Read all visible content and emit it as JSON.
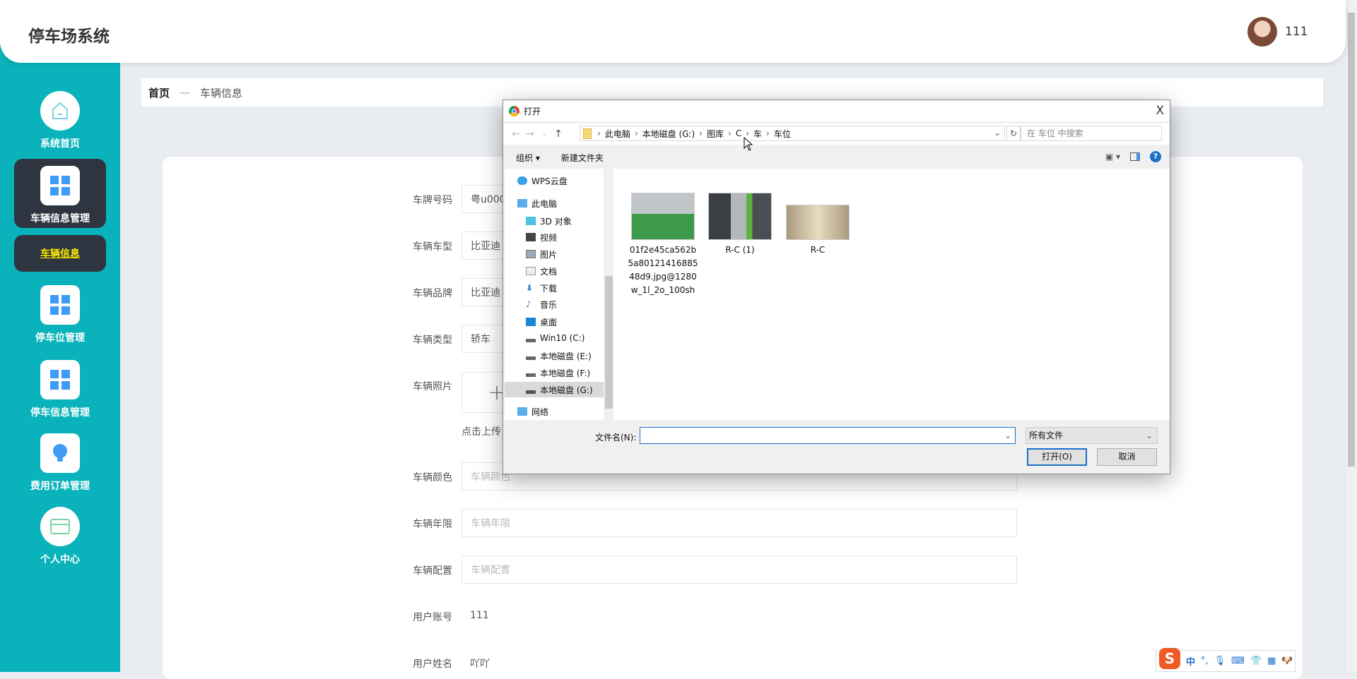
{
  "header": {
    "title": "停车场系统",
    "user": "111"
  },
  "sidebar": {
    "items": [
      {
        "label": "系统首页",
        "icon": "home-icon"
      },
      {
        "label": "车辆信息管理",
        "icon": "grid-icon",
        "active": true
      },
      {
        "label": "停车位管理",
        "icon": "grid-icon"
      },
      {
        "label": "停车信息管理",
        "icon": "grid-icon"
      },
      {
        "label": "费用订单管理",
        "icon": "lightbulb-icon"
      },
      {
        "label": "个人中心",
        "icon": "card-icon"
      }
    ],
    "sub_item": "车辆信息",
    "accent": "#0ab3bb"
  },
  "breadcrumb": {
    "home": "首页",
    "sep": "—",
    "current": "车辆信息"
  },
  "form": {
    "plate": {
      "label": "车牌号码",
      "value": "粤u000"
    },
    "model": {
      "label": "车辆车型",
      "value": "比亚迪"
    },
    "brand": {
      "label": "车辆品牌",
      "value": "比亚迪"
    },
    "type": {
      "label": "车辆类型",
      "value": "轿车"
    },
    "photo": {
      "label": "车辆照片",
      "plus": "+",
      "hint": "点击上传"
    },
    "color": {
      "label": "车辆颜色",
      "placeholder": "车辆颜色"
    },
    "years": {
      "label": "车辆年限",
      "placeholder": "车辆年限"
    },
    "config": {
      "label": "车辆配置",
      "placeholder": "车辆配置"
    },
    "account": {
      "label": "用户账号",
      "value": "111"
    },
    "name": {
      "label": "用户姓名",
      "value": "吖吖"
    }
  },
  "dialog": {
    "title": "打开",
    "close": "X",
    "path": [
      "此电脑",
      "本地磁盘 (G:)",
      "图库",
      "C",
      "车",
      "车位"
    ],
    "search_placeholder": "在 车位 中搜索",
    "toolbar": {
      "organize": "组织 ▾",
      "new_folder": "新建文件夹"
    },
    "nav": [
      "WPS云盘",
      "此电脑",
      "3D 对象",
      "视频",
      "图片",
      "文档",
      "下载",
      "音乐",
      "桌面",
      "Win10 (C:)",
      "本地磁盘 (E:)",
      "本地磁盘 (F:)",
      "本地磁盘 (G:)",
      "网络"
    ],
    "selected_nav": "本地磁盘 (G:)",
    "files": [
      {
        "name": "01f2e45ca562b5a8012141688548d9.jpg@1280w_1l_2o_100sh"
      },
      {
        "name": "R-C (1)"
      },
      {
        "name": "R-C"
      }
    ],
    "filename_label": "文件名(N):",
    "filename_value": "",
    "filter": "所有文件",
    "open_label": "打开(O)",
    "cancel_label": "取消"
  },
  "ime": {
    "lang": "中",
    "punct": "°,"
  }
}
